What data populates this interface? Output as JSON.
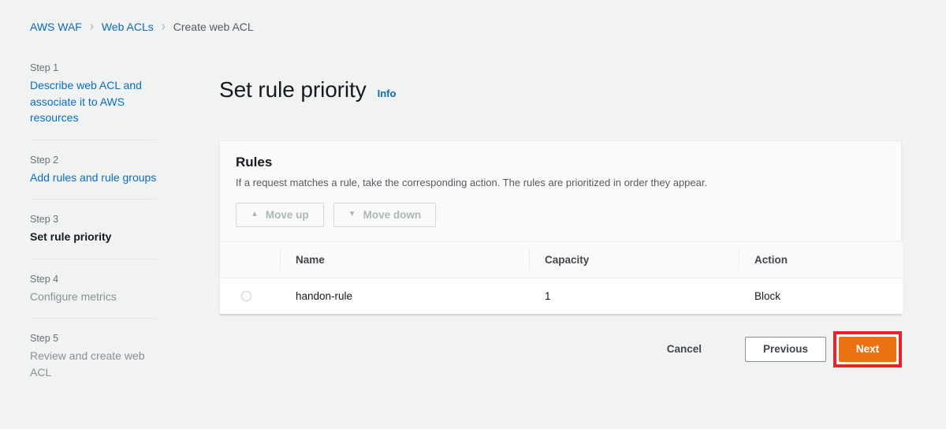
{
  "breadcrumb": {
    "separator": "›",
    "items": [
      {
        "label": "AWS WAF",
        "current": false
      },
      {
        "label": "Web ACLs",
        "current": false
      },
      {
        "label": "Create web ACL",
        "current": true
      }
    ]
  },
  "sidebar": {
    "steps": [
      {
        "number": "Step 1",
        "title": "Describe web ACL and associate it to AWS resources",
        "state": "link"
      },
      {
        "number": "Step 2",
        "title": "Add rules and rule groups",
        "state": "link"
      },
      {
        "number": "Step 3",
        "title": "Set rule priority",
        "state": "current"
      },
      {
        "number": "Step 4",
        "title": "Configure metrics",
        "state": "future"
      },
      {
        "number": "Step 5",
        "title": "Review and create web ACL",
        "state": "future"
      }
    ]
  },
  "page": {
    "title": "Set rule priority",
    "info_label": "Info"
  },
  "card": {
    "title": "Rules",
    "description": "If a request matches a rule, take the corresponding action. The rules are prioritized in order they appear.",
    "move_up_label": "Move up",
    "move_up_icon": "triangle-up-icon",
    "move_up_glyph": "▲",
    "move_down_label": "Move down",
    "move_down_icon": "triangle-down-icon",
    "move_down_glyph": "▼",
    "table": {
      "columns": [
        "Name",
        "Capacity",
        "Action"
      ],
      "rows": [
        {
          "selected": false,
          "name": "handon-rule",
          "capacity": "1",
          "action": "Block"
        }
      ]
    }
  },
  "footer": {
    "cancel_label": "Cancel",
    "previous_label": "Previous",
    "next_label": "Next"
  },
  "colors": {
    "page_background": "#f1f3f3",
    "link_blue": "#0a6cbf",
    "primary_orange": "#ec7211",
    "highlight_red": "#e8242a",
    "text_dark": "#16191f",
    "text_muted": "#687078",
    "disabled_gray": "#aab7b8"
  }
}
